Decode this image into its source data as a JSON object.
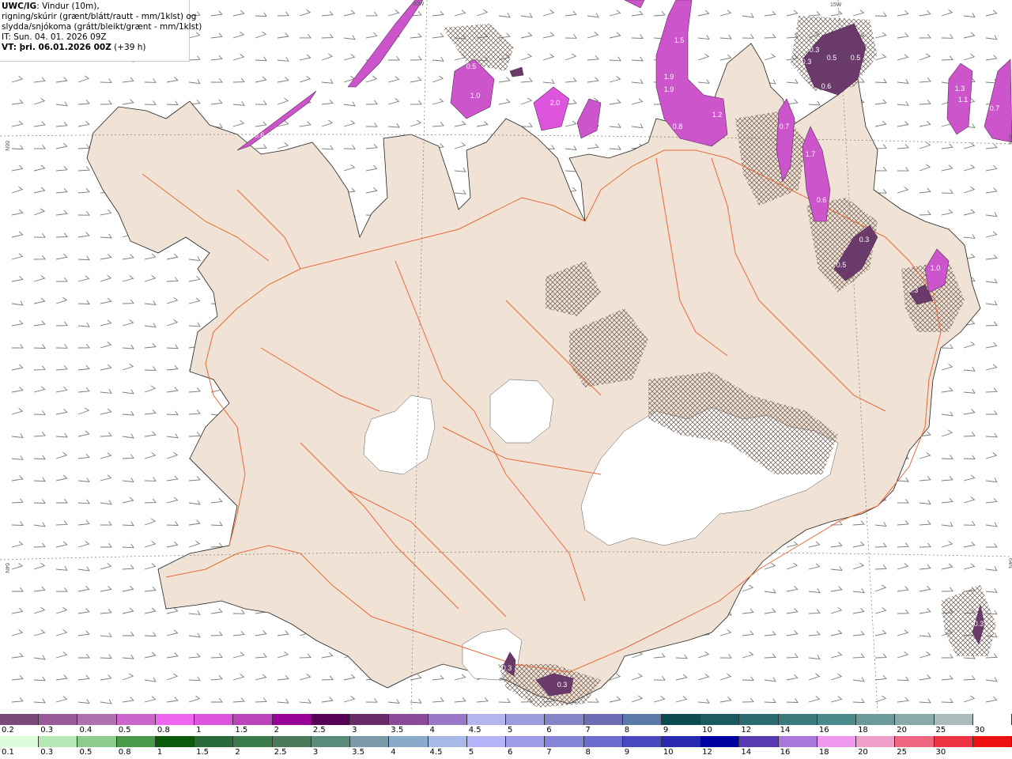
{
  "header": {
    "product": "UWC/IG",
    "line1_rest": ": Vindur (10m),",
    "line2": "rigning/skúrir (grænt/blátt/rautt - mm/1klst) og",
    "line3": "slydda/snjókoma (grátt/bleikt/grænt - mm/1klst)",
    "it": "IT: Sun. 04. 01. 2026 09Z",
    "vt_label": "VT: þri. 06.01.2026 00Z",
    "vt_rest": "(+39 h)"
  },
  "graticule_labels": [
    "20W",
    "15W",
    "66N",
    "66N",
    "64N",
    "64N"
  ],
  "precip_labels": [
    "0.5",
    "1.0",
    "0.6",
    "2.0",
    "1.5",
    "1.9",
    "1.9",
    "0.8",
    "1.2",
    "0.3",
    "0.5",
    "0.5",
    "0.3",
    "0.6",
    "0.7",
    "1.7",
    "0.6",
    "0.3",
    "0.5",
    "1.0",
    "0.3",
    "1.1",
    "1.3",
    "0.7",
    "0.3",
    "0.3",
    "0.3"
  ],
  "snow_scale": {
    "labels": [
      "0.2",
      "0.3",
      "0.4",
      "0.5",
      "0.8",
      "1",
      "1.5",
      "2",
      "2.5",
      "3",
      "3.5",
      "4",
      "4.5",
      "5",
      "6",
      "7",
      "8",
      "9",
      "10",
      "12",
      "14",
      "16",
      "18",
      "20",
      "25",
      "30"
    ],
    "colors": [
      "#7a4a7a",
      "#9a5a9a",
      "#b070b0",
      "#cc66cc",
      "#ee66ee",
      "#dd55dd",
      "#bb44bb",
      "#990099",
      "#550055",
      "#6a2a6a",
      "#8a4a9a",
      "#9a78c8",
      "#b4b4ee",
      "#9c9cdc",
      "#8484c8",
      "#6c6cb4",
      "#5a78a8",
      "#0a4a50",
      "#1a5a60",
      "#2a6a70",
      "#3a7a7a",
      "#4a8a8a",
      "#6a9a9a",
      "#8aaaaa",
      "#aabbbb",
      "#ffffff"
    ]
  },
  "rain_scale": {
    "labels": [
      "0.1",
      "0.3",
      "0.5",
      "0.8",
      "1",
      "1.5",
      "2",
      "2.5",
      "3",
      "3.5",
      "4",
      "4.5",
      "5",
      "6",
      "7",
      "8",
      "9",
      "10",
      "12",
      "14",
      "16",
      "18",
      "20",
      "25",
      "30"
    ],
    "colors": [
      "#ddfcdc",
      "#b4e8b4",
      "#8ccc8c",
      "#4a9a4a",
      "#0a5a0a",
      "#2a6a3a",
      "#3a7a4a",
      "#4a7a5a",
      "#5a8a7a",
      "#7a9aaa",
      "#8aaacc",
      "#a8b8e8",
      "#b4b4f8",
      "#9c9ce8",
      "#8484d8",
      "#6c6cd0",
      "#4848c0",
      "#2828b0",
      "#0000a0",
      "#5a3ab4",
      "#aa77dd",
      "#ee99ee",
      "#f0a0c8",
      "#ee6680",
      "#ee3344",
      "#ee1111"
    ]
  }
}
